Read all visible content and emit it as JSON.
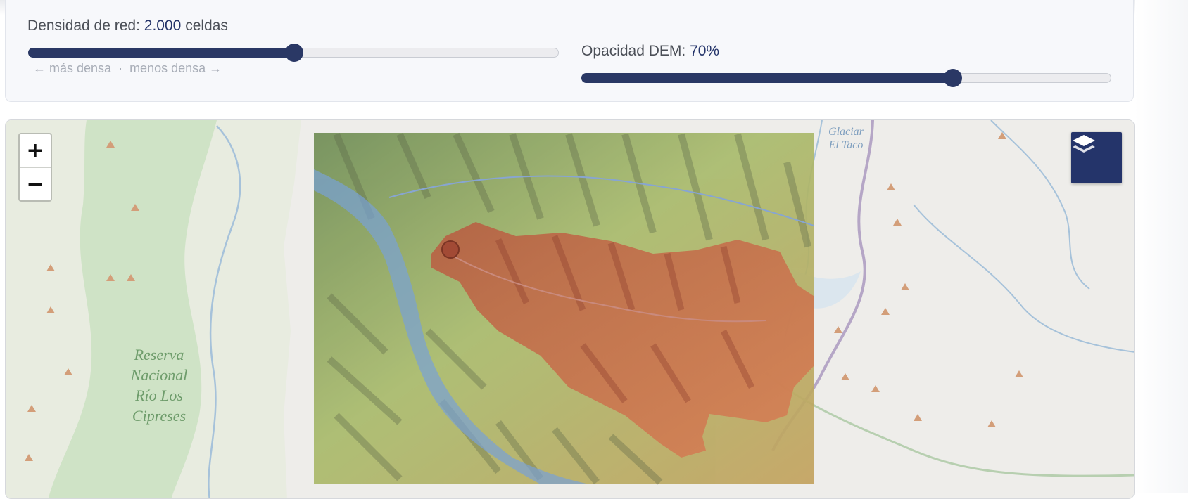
{
  "controls": {
    "density": {
      "label": "Densidad de red:",
      "value": "2.000",
      "unit": "celdas",
      "level": 0.5,
      "hint_left": "← más densa",
      "hint_sep": "·",
      "hint_right": "menos densa →"
    },
    "opacity": {
      "label": "Opacidad DEM:",
      "value": "70%",
      "level": 0.7
    }
  },
  "map": {
    "zoom_in": "+",
    "zoom_out": "−",
    "layers_icon": "layers-icon",
    "labels": {
      "reserve": [
        "Reserva",
        "Nacional",
        "Río Los",
        "Cipreses"
      ],
      "glacier": [
        "Glaciar",
        "El Taco"
      ]
    }
  },
  "colors": {
    "accent": "#24346a",
    "basemap": "#eeedea",
    "park": "#cfe3c6",
    "water": "#a6c2da",
    "basin": "#c8624a"
  }
}
